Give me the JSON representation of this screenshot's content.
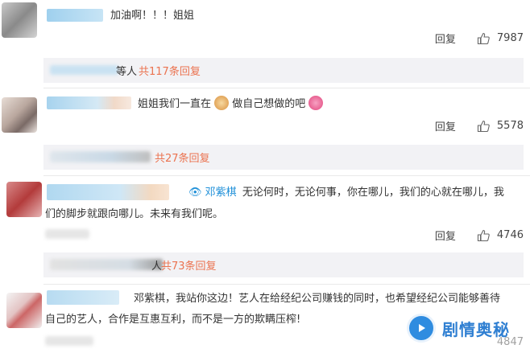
{
  "comments": [
    {
      "text": "加油啊！！！姐姐",
      "reply_label": "回复",
      "likes": "7987",
      "sub_reply_suffix": "等人",
      "sub_reply_count": "共117条回复"
    },
    {
      "text_a": "姐姐我们一直在",
      "text_b": "做自己想做的吧",
      "reply_label": "回复",
      "likes": "5578",
      "sub_reply_count": "共27条回复"
    },
    {
      "mention": "邓紫棋",
      "text_line1": "无论何时，无论何事，你在哪儿，我们的心就在哪儿，我",
      "text_line2": "们的脚步就跟向哪儿。未来有我们呢。",
      "reply_label": "回复",
      "likes": "4746",
      "sub_reply_suffix": "人",
      "sub_reply_count": "共73条回复"
    },
    {
      "text_line1": "邓紫棋，我站你这边！艺人在给经纪公司赚钱的同时，也希望经纪公司能够善待",
      "text_line2": "自己的艺人，合作是互惠互利，而不是一方的欺瞒压榨!",
      "likes_partial": "4847"
    }
  ],
  "watermark": {
    "text": "剧情奥秘"
  },
  "colors": {
    "accent": "#eb7350",
    "link": "#1e8fd8",
    "sub_bg": "#f2f2f5"
  }
}
